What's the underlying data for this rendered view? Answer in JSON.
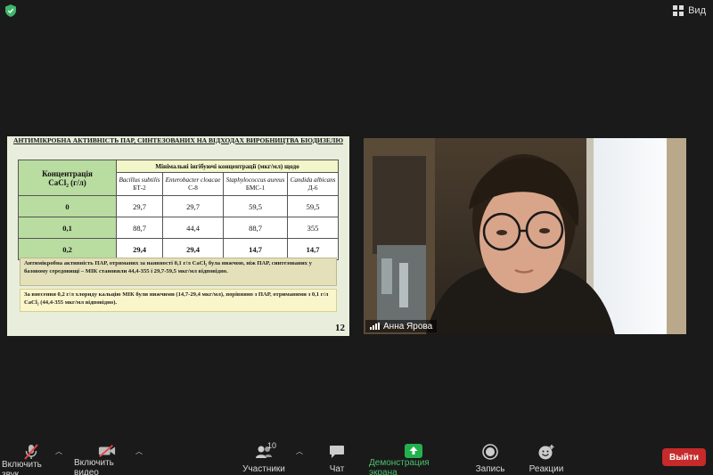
{
  "top": {
    "view_label": "Вид",
    "shield_color": "#3fb56a"
  },
  "slide": {
    "title": "АНТИМІКРОБНА АКТИВНІСТЬ ПАР, СИНТЕЗОВАНИХ НА ВІДХОДАХ ВИРОБНИЦТВА БІОДИЗЕЛЮ",
    "conc_header_line1": "Концентрація",
    "conc_header_line2": "CaCl₂ (г/л)",
    "mic_header": "Мінімальні інгібуючі концентрації (мкг/мл) щодо",
    "organisms": [
      {
        "name": "Bacillus subtilis",
        "strain": "БТ-2"
      },
      {
        "name": "Enterobacter cloacae",
        "strain": "С-8"
      },
      {
        "name": "Staphylococcus aureus",
        "strain": "БМС-1"
      },
      {
        "name": "Candida albicans",
        "strain": "Д-6"
      }
    ],
    "rows": [
      {
        "conc": "0",
        "values": [
          "29,7",
          "29,7",
          "59,5",
          "59,5"
        ]
      },
      {
        "conc": "0,1",
        "values": [
          "88,7",
          "44,4",
          "88,7",
          "355"
        ]
      },
      {
        "conc": "0,2",
        "values": [
          "29,4",
          "29,4",
          "14,7",
          "14,7"
        ]
      }
    ],
    "note1": "Антимікробна активність ПАР, отриманих за наявності 0,1 г/л CaCl₂ була нижчою, ніж ПАР, синтезованих у базовому середовищі – МІК становили 44,4-355 і 29,7-59,5 мкг/мл відповідно.",
    "note2": "За внесення 0,2 г/л хлориду кальцію МІК були нижчими (14,7-29,4 мкг/мл), порівняно з ПАР, отриманими з 0,1 г/л CaCl₂ (44,4-355 мкг/мл відповідно).",
    "page_number": "12"
  },
  "video": {
    "participant_name": "Анна Ярова"
  },
  "toolbar": {
    "mute_label": "Включить звук",
    "video_label": "Включить видео",
    "participants_label": "Участники",
    "participants_count": "10",
    "chat_label": "Чат",
    "share_label": "Демонстрация экрана",
    "record_label": "Запись",
    "reactions_label": "Реакции",
    "leave_label": "Выйти",
    "share_color": "#23b14d",
    "leave_color": "#c62a2a"
  }
}
